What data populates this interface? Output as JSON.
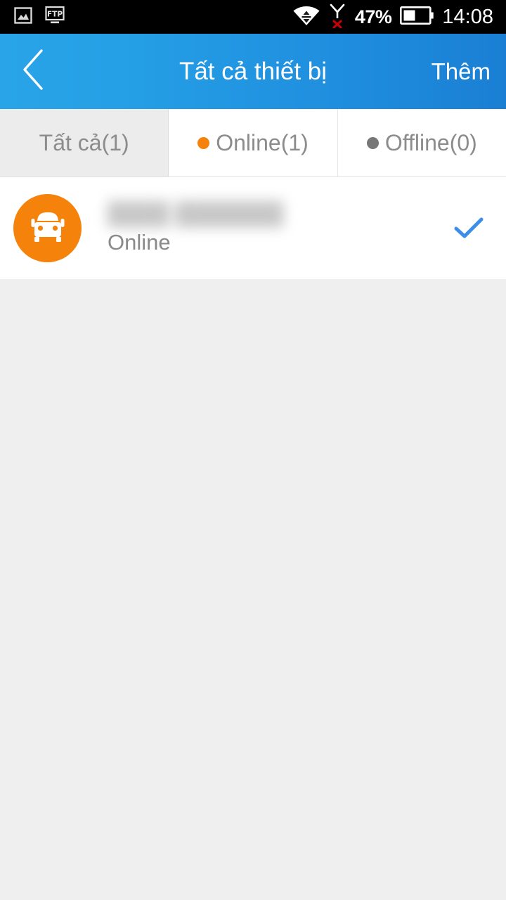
{
  "status_bar": {
    "left_icons": [
      {
        "name": "photo-icon",
        "label": "screenshot"
      },
      {
        "name": "ftp-icon",
        "label": "FTP"
      }
    ],
    "wifi_icon": "wifi-transfer-icon",
    "signal_icon": "signal-no-service-icon",
    "battery_percent": "47%",
    "battery_icon": "battery-half-icon",
    "clock": "14:08"
  },
  "header": {
    "back_icon": "chevron-left-icon",
    "title": "Tất cả thiết bị",
    "action_label": "Thêm",
    "gradient_start": "#29a4e8",
    "gradient_end": "#1a7fd4"
  },
  "tabs": [
    {
      "label": "Tất cả(1)",
      "dot": null,
      "active": true,
      "name": "tab-all"
    },
    {
      "label": "Online(1)",
      "dot": "#f5820b",
      "active": false,
      "name": "tab-online"
    },
    {
      "label": "Offline(0)",
      "dot": "#777777",
      "active": false,
      "name": "tab-offline"
    }
  ],
  "device_list": {
    "items": [
      {
        "avatar_icon": "car-icon",
        "avatar_color": "#f5820b",
        "name": "████ ███████",
        "status": "Online",
        "selected": true,
        "check_color": "#3d8ee8"
      }
    ]
  }
}
